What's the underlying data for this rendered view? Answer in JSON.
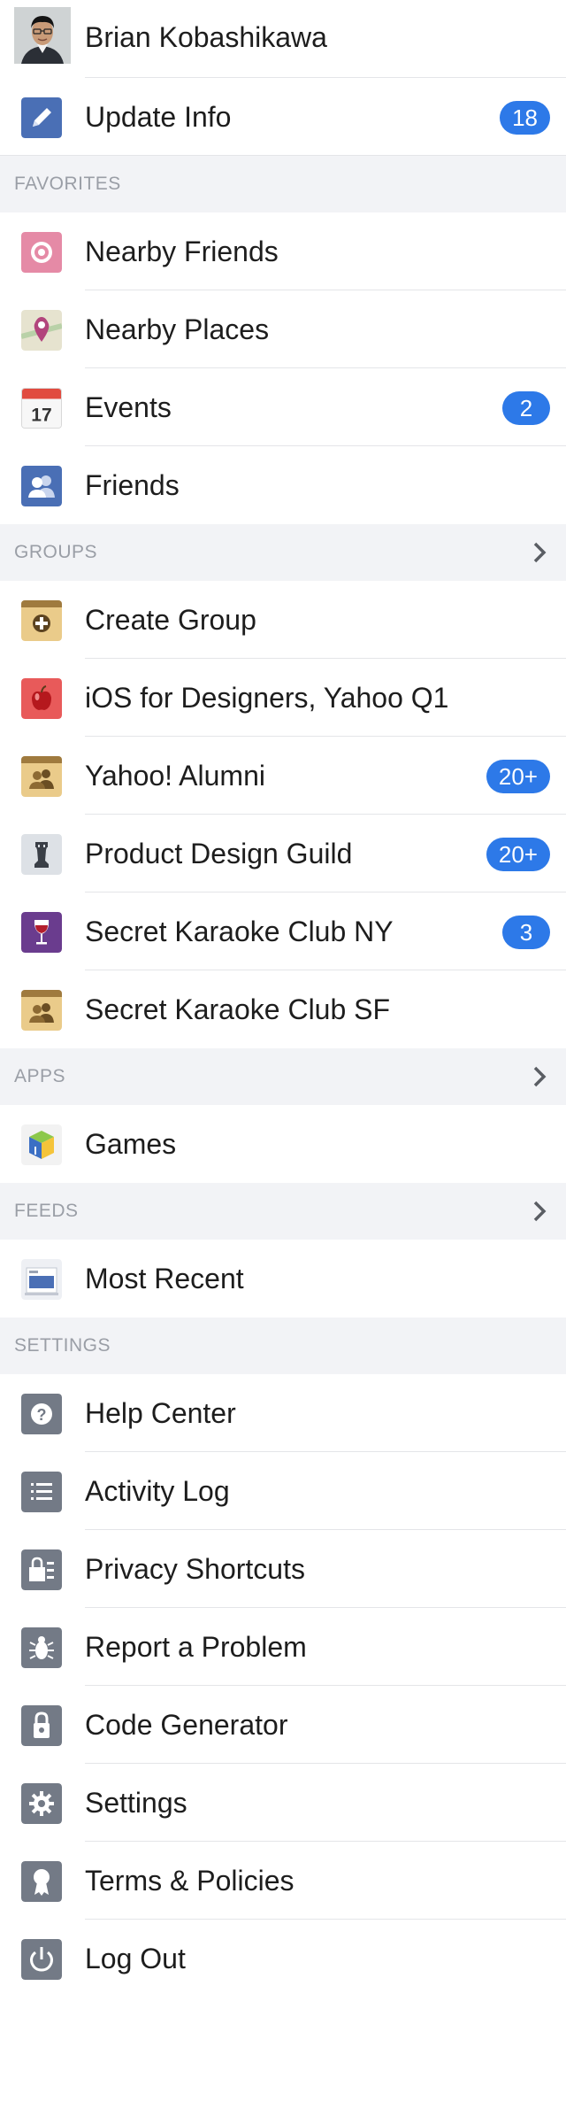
{
  "profile": {
    "name": "Brian Kobashikawa"
  },
  "update_info": {
    "label": "Update Info",
    "badge": "18"
  },
  "favorites": {
    "title": "FAVORITES",
    "items": [
      {
        "label": "Nearby Friends",
        "icon": "nearby-friends-icon"
      },
      {
        "label": "Nearby Places",
        "icon": "nearby-places-icon"
      },
      {
        "label": "Events",
        "icon": "events-icon",
        "icon_text": "17",
        "badge": "2"
      },
      {
        "label": "Friends",
        "icon": "friends-icon"
      }
    ]
  },
  "groups": {
    "title": "GROUPS",
    "items": [
      {
        "label": "Create Group",
        "icon": "create-group-icon"
      },
      {
        "label": "iOS for Designers, Yahoo Q1",
        "icon": "apple-icon"
      },
      {
        "label": "Yahoo! Alumni",
        "icon": "group-icon",
        "badge": "20+"
      },
      {
        "label": "Product Design Guild",
        "icon": "chess-rook-icon",
        "badge": "20+"
      },
      {
        "label": "Secret Karaoke Club NY",
        "icon": "wine-glass-icon",
        "badge": "3"
      },
      {
        "label": "Secret Karaoke Club SF",
        "icon": "group-icon"
      }
    ]
  },
  "apps": {
    "title": "APPS",
    "items": [
      {
        "label": "Games",
        "icon": "games-cube-icon"
      }
    ]
  },
  "feeds": {
    "title": "FEEDS",
    "items": [
      {
        "label": "Most Recent",
        "icon": "news-feed-icon"
      }
    ]
  },
  "settings": {
    "title": "SETTINGS",
    "items": [
      {
        "label": "Help Center",
        "icon": "help-icon"
      },
      {
        "label": "Activity Log",
        "icon": "activity-log-icon"
      },
      {
        "label": "Privacy Shortcuts",
        "icon": "privacy-lock-icon"
      },
      {
        "label": "Report a Problem",
        "icon": "bug-icon"
      },
      {
        "label": "Code Generator",
        "icon": "code-lock-icon"
      },
      {
        "label": "Settings",
        "icon": "gear-icon"
      },
      {
        "label": "Terms & Policies",
        "icon": "ribbon-icon"
      },
      {
        "label": "Log Out",
        "icon": "power-icon"
      }
    ]
  },
  "colors": {
    "badge": "#2d79e8",
    "section_bg": "#f2f3f6",
    "section_text": "#9a9ea6",
    "separator": "#e4e5e8"
  }
}
